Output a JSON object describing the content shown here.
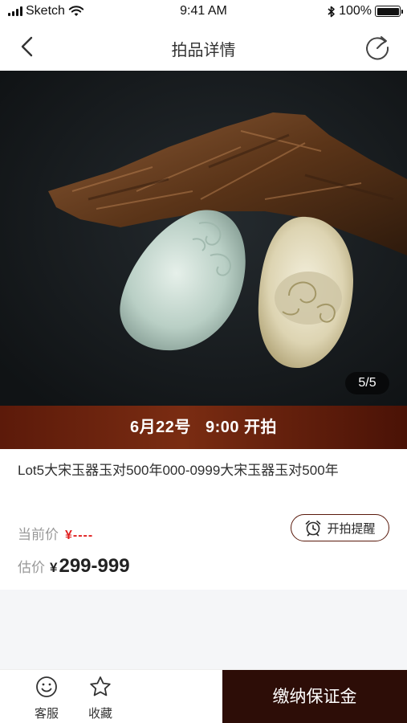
{
  "status_bar": {
    "carrier": "Sketch",
    "time": "9:41 AM",
    "battery": "100%"
  },
  "nav": {
    "title": "拍品详情"
  },
  "hero": {
    "image_counter": "5/5"
  },
  "banner": {
    "date": "6月22号",
    "time": "9:00",
    "action": "开拍"
  },
  "lot": {
    "title": "Lot5大宋玉器玉对500年000-0999大宋玉器玉对500年",
    "current_price_label": "当前价",
    "current_price_value": "¥----",
    "remind_label": "开拍提醒",
    "estimate_label": "估价",
    "estimate_currency": "¥",
    "estimate_value": "299-999"
  },
  "bottom": {
    "service_label": "客服",
    "favorite_label": "收藏",
    "deposit_label": "缴纳保证金"
  },
  "colors": {
    "accent": "#5a1a0c",
    "price_red": "#e02020",
    "deposit_bg": "#2d0d07"
  }
}
